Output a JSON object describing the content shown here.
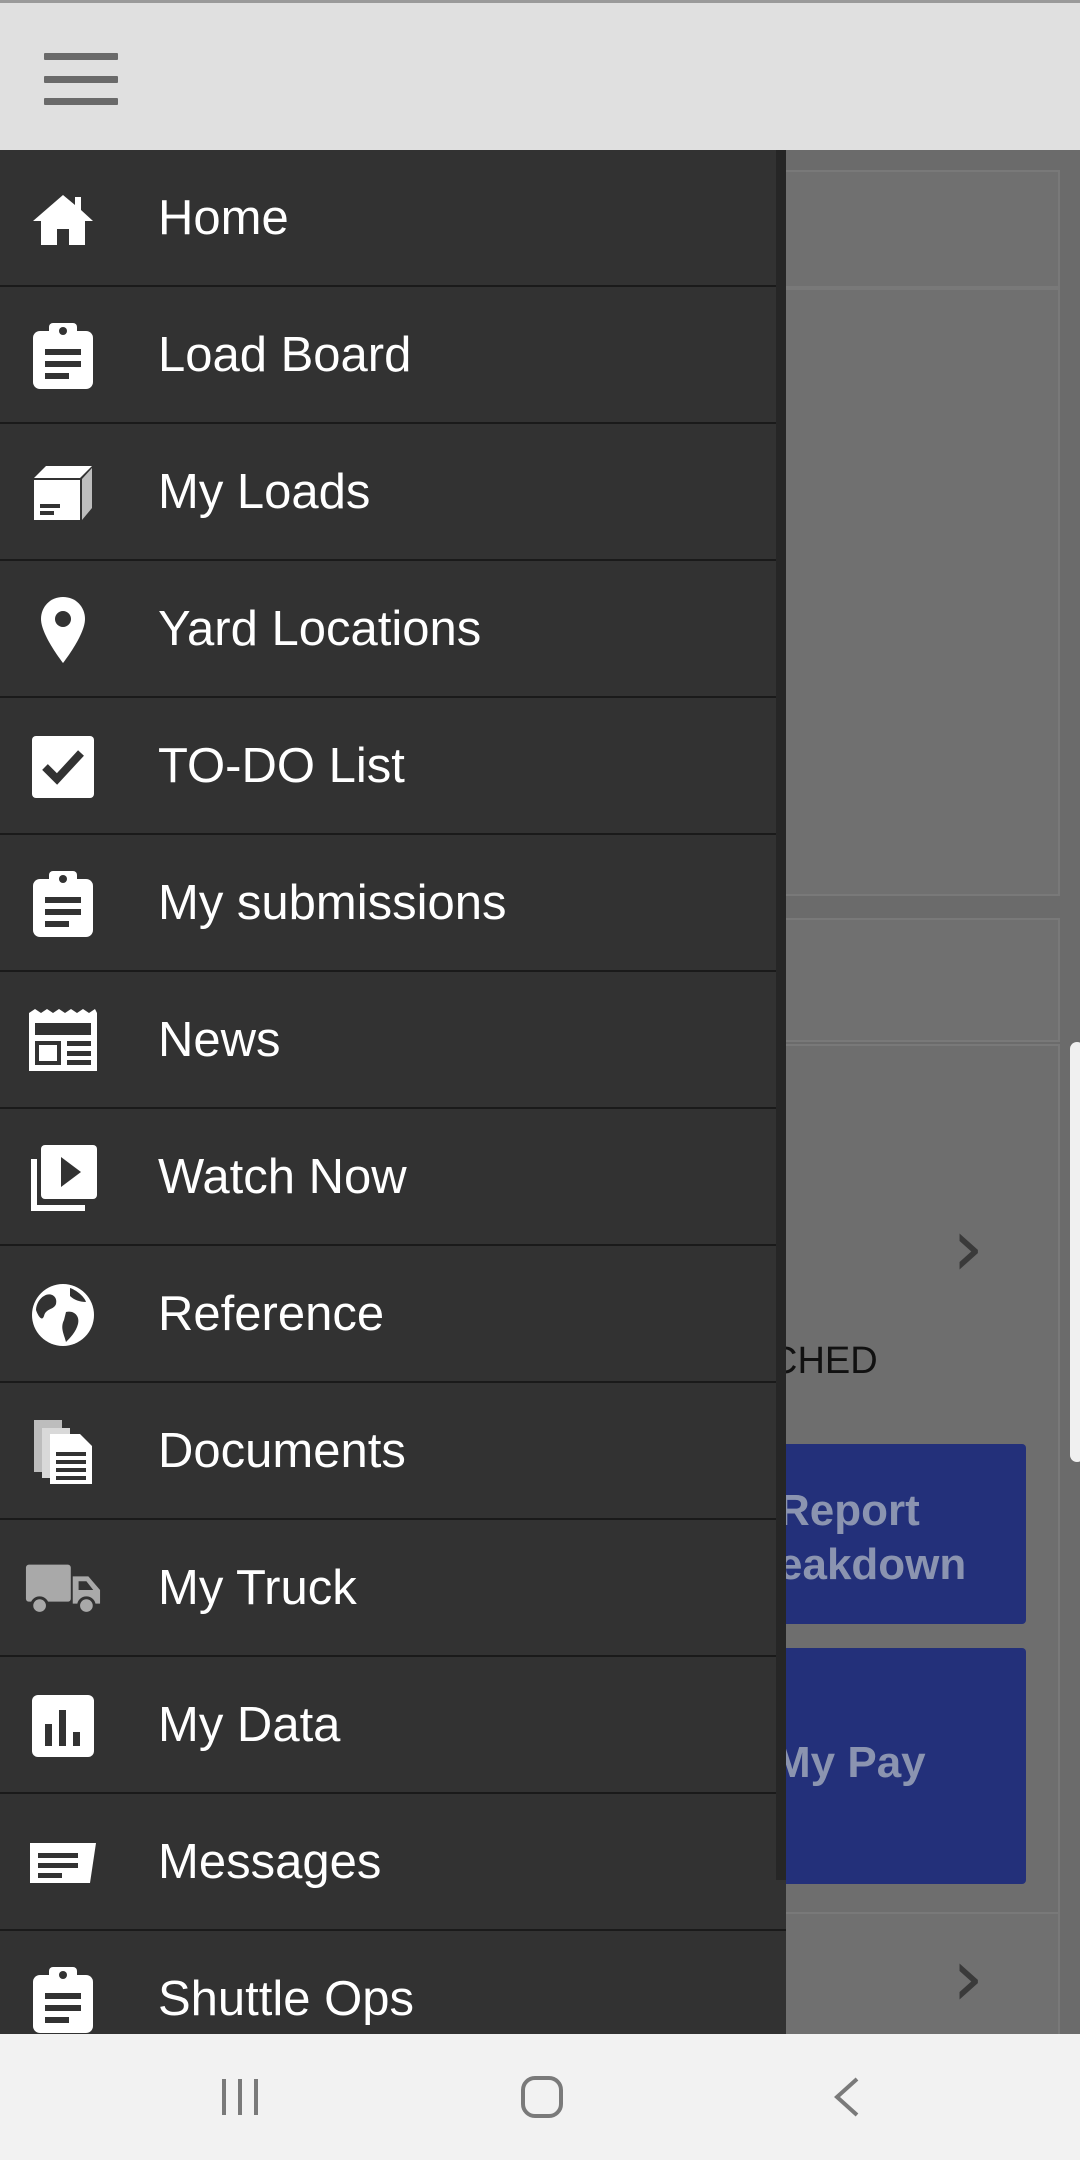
{
  "colors": {
    "topbar": "#e0e0e0",
    "drawer": "#323232",
    "tile": "#23307a",
    "icon": "#ffffff"
  },
  "topbar": {
    "menu_icon": "hamburger-menu-icon"
  },
  "drawer": {
    "items": [
      {
        "label": "Home",
        "icon": "home-icon"
      },
      {
        "label": "Load Board",
        "icon": "clipboard-icon"
      },
      {
        "label": "My Loads",
        "icon": "box-icon"
      },
      {
        "label": "Yard Locations",
        "icon": "map-pin-icon"
      },
      {
        "label": "TO-DO List",
        "icon": "checkbox-icon"
      },
      {
        "label": "My submissions",
        "icon": "clipboard-icon"
      },
      {
        "label": "News",
        "icon": "newspaper-icon"
      },
      {
        "label": "Watch Now",
        "icon": "video-library-icon"
      },
      {
        "label": "Reference",
        "icon": "globe-icon"
      },
      {
        "label": "Documents",
        "icon": "documents-icon"
      },
      {
        "label": "My Truck",
        "icon": "truck-icon"
      },
      {
        "label": "My Data",
        "icon": "bar-chart-icon"
      },
      {
        "label": "Messages",
        "icon": "message-icon"
      },
      {
        "label": "Shuttle Ops",
        "icon": "clipboard-icon"
      }
    ]
  },
  "background": {
    "matched_text": "CHED",
    "report_tile": {
      "line1": "Report",
      "line2": "eakdown"
    },
    "pay_tile": "My Pay"
  },
  "navbar": {
    "recent": "recent-apps-icon",
    "home": "home-button-icon",
    "back": "back-icon"
  }
}
